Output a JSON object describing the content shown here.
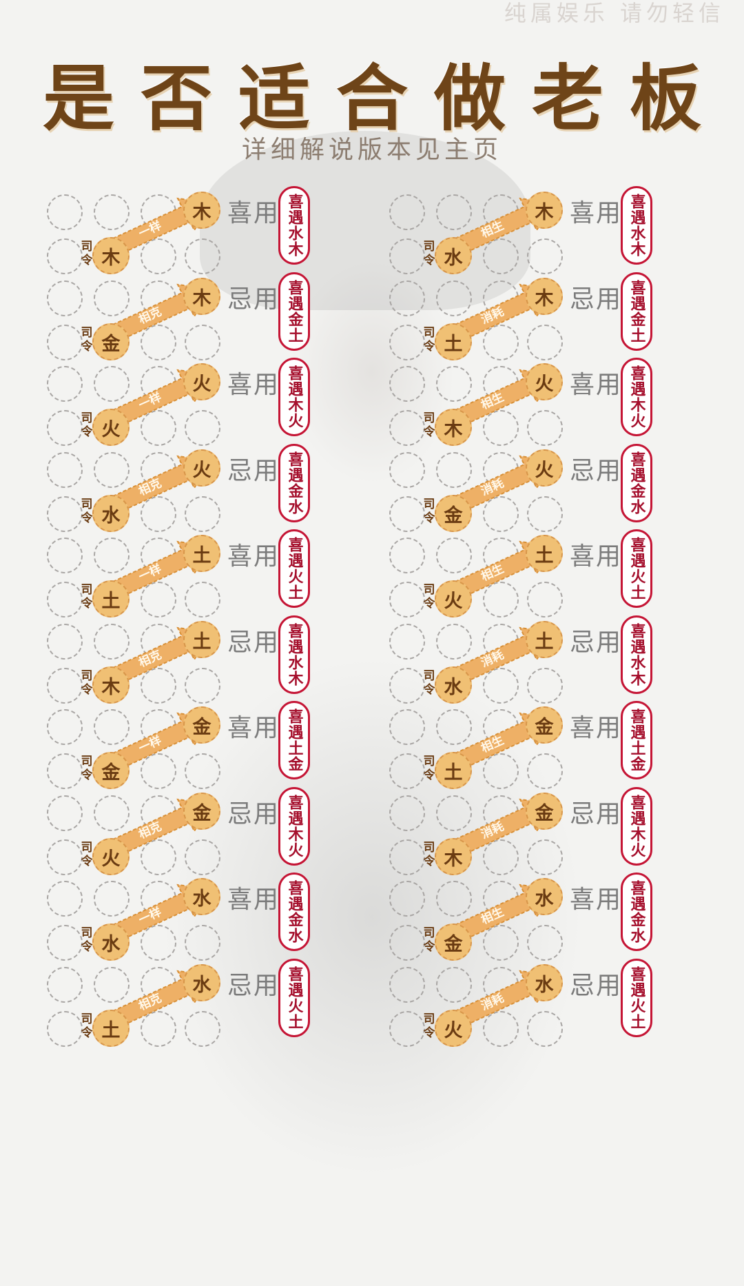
{
  "watermark": "纯属娱乐 请勿轻信",
  "title": "是否适合做老板",
  "subtitle": "详细解说版本见主页",
  "siling_label": "司令",
  "colors": {
    "title": "#6e4418",
    "element_fill": "#f0c074",
    "arrow": "#eeb066",
    "pill_border": "#c51535",
    "pill_text": "#a50f2c"
  },
  "rows": [
    {
      "left": {
        "siling": "木",
        "relation": "一样",
        "target": "木",
        "usage": "喜用",
        "badge": "喜遇水木"
      },
      "right": {
        "siling": "水",
        "relation": "相生",
        "target": "木",
        "usage": "喜用",
        "badge": "喜遇水木"
      }
    },
    {
      "left": {
        "siling": "金",
        "relation": "相克",
        "target": "木",
        "usage": "忌用",
        "badge": "喜遇金土"
      },
      "right": {
        "siling": "土",
        "relation": "消耗",
        "target": "木",
        "usage": "忌用",
        "badge": "喜遇金土"
      }
    },
    {
      "left": {
        "siling": "火",
        "relation": "一样",
        "target": "火",
        "usage": "喜用",
        "badge": "喜遇木火"
      },
      "right": {
        "siling": "木",
        "relation": "相生",
        "target": "火",
        "usage": "喜用",
        "badge": "喜遇木火"
      }
    },
    {
      "left": {
        "siling": "水",
        "relation": "相克",
        "target": "火",
        "usage": "忌用",
        "badge": "喜遇金水"
      },
      "right": {
        "siling": "金",
        "relation": "消耗",
        "target": "火",
        "usage": "忌用",
        "badge": "喜遇金水"
      }
    },
    {
      "left": {
        "siling": "土",
        "relation": "一样",
        "target": "土",
        "usage": "喜用",
        "badge": "喜遇火土"
      },
      "right": {
        "siling": "火",
        "relation": "相生",
        "target": "土",
        "usage": "喜用",
        "badge": "喜遇火土"
      }
    },
    {
      "left": {
        "siling": "木",
        "relation": "相克",
        "target": "土",
        "usage": "忌用",
        "badge": "喜遇水木"
      },
      "right": {
        "siling": "水",
        "relation": "消耗",
        "target": "土",
        "usage": "忌用",
        "badge": "喜遇水木"
      }
    },
    {
      "left": {
        "siling": "金",
        "relation": "一样",
        "target": "金",
        "usage": "喜用",
        "badge": "喜遇土金"
      },
      "right": {
        "siling": "土",
        "relation": "相生",
        "target": "金",
        "usage": "喜用",
        "badge": "喜遇土金"
      }
    },
    {
      "left": {
        "siling": "火",
        "relation": "相克",
        "target": "金",
        "usage": "忌用",
        "badge": "喜遇木火"
      },
      "right": {
        "siling": "木",
        "relation": "消耗",
        "target": "金",
        "usage": "忌用",
        "badge": "喜遇木火"
      }
    },
    {
      "left": {
        "siling": "水",
        "relation": "一样",
        "target": "水",
        "usage": "喜用",
        "badge": "喜遇金水"
      },
      "right": {
        "siling": "金",
        "relation": "相生",
        "target": "水",
        "usage": "喜用",
        "badge": "喜遇金水"
      }
    },
    {
      "left": {
        "siling": "土",
        "relation": "相克",
        "target": "水",
        "usage": "忌用",
        "badge": "喜遇火土"
      },
      "right": {
        "siling": "火",
        "relation": "消耗",
        "target": "水",
        "usage": "忌用",
        "badge": "喜遇火土"
      }
    }
  ]
}
